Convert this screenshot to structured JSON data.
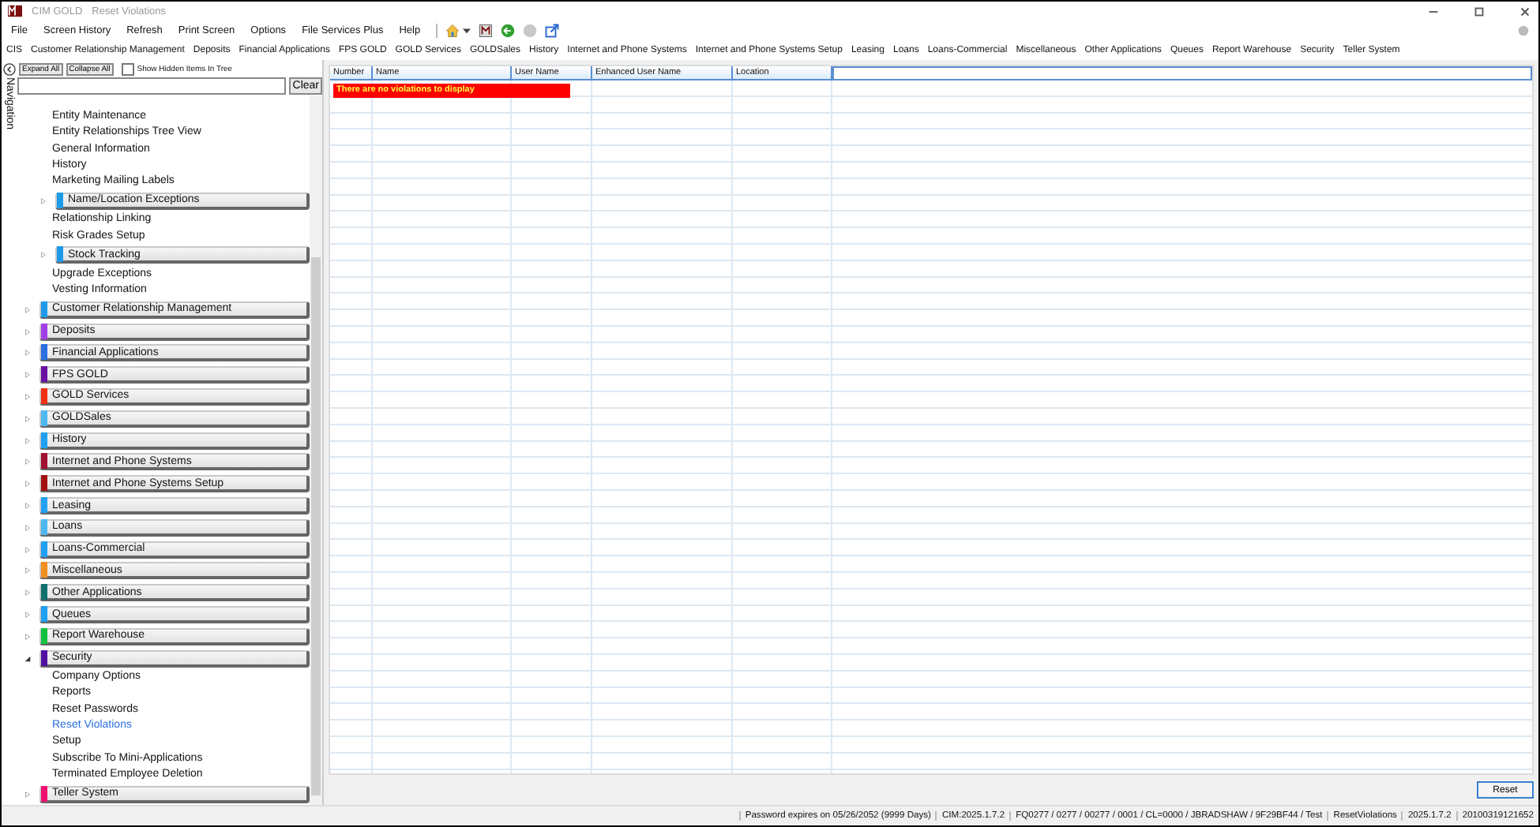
{
  "window": {
    "app_name": "CIM GOLD",
    "title": "Reset Violations"
  },
  "menu": [
    "File",
    "Screen History",
    "Refresh",
    "Print Screen",
    "Options",
    "File Services Plus",
    "Help"
  ],
  "modules": [
    "CIS",
    "Customer Relationship Management",
    "Deposits",
    "Financial Applications",
    "FPS GOLD",
    "GOLD Services",
    "GOLDSales",
    "History",
    "Internet and Phone Systems",
    "Internet and Phone Systems Setup",
    "Leasing",
    "Loans",
    "Loans-Commercial",
    "Miscellaneous",
    "Other Applications",
    "Queues",
    "Report Warehouse",
    "Security",
    "Teller System"
  ],
  "navigation": {
    "label": "Navigation",
    "expand_all": "Expand All",
    "collapse_all": "Collapse All",
    "show_hidden": {
      "label": "Show Hidden Items In Tree",
      "checked": false
    },
    "clear": "Clear",
    "continued_items": [
      {
        "kind": "leaf",
        "label": "Entity Maintenance",
        "selected": false
      },
      {
        "kind": "leaf",
        "label": "Entity Relationships Tree View",
        "selected": false
      },
      {
        "kind": "leaf",
        "label": "General Information",
        "selected": false
      },
      {
        "kind": "leaf",
        "label": "History",
        "selected": false
      },
      {
        "kind": "leaf",
        "label": "Marketing Mailing Labels",
        "selected": false
      },
      {
        "kind": "group",
        "label": "Name/Location Exceptions",
        "color": "#1e9be8",
        "expanded": false
      },
      {
        "kind": "leaf",
        "label": "Relationship Linking",
        "selected": false
      },
      {
        "kind": "leaf",
        "label": "Risk Grades Setup",
        "selected": false
      },
      {
        "kind": "group",
        "label": "Stock Tracking",
        "color": "#1e9be8",
        "expanded": false
      },
      {
        "kind": "leaf",
        "label": "Upgrade Exceptions",
        "selected": false
      },
      {
        "kind": "leaf",
        "label": "Vesting Information",
        "selected": false
      }
    ],
    "groups": [
      {
        "label": "Customer Relationship Management",
        "color": "#1e9be8",
        "expanded": false
      },
      {
        "label": "Deposits",
        "color": "#a040e8",
        "expanded": false
      },
      {
        "label": "Financial Applications",
        "color": "#2a6ee0",
        "expanded": false
      },
      {
        "label": "FPS GOLD",
        "color": "#6a10a0",
        "expanded": false
      },
      {
        "label": "GOLD Services",
        "color": "#f03010",
        "expanded": false
      },
      {
        "label": "GOLDSales",
        "color": "#50b8f0",
        "expanded": false
      },
      {
        "label": "History",
        "color": "#20a0f0",
        "expanded": false
      },
      {
        "label": "Internet and Phone Systems",
        "color": "#a01030",
        "expanded": false
      },
      {
        "label": "Internet and Phone Systems Setup",
        "color": "#a01010",
        "expanded": false
      },
      {
        "label": "Leasing",
        "color": "#20a0f0",
        "expanded": false
      },
      {
        "label": "Loans",
        "color": "#50b8f0",
        "expanded": false
      },
      {
        "label": "Loans-Commercial",
        "color": "#20a0f1",
        "expanded": false
      },
      {
        "label": "Miscellaneous",
        "color": "#f09020",
        "expanded": false
      },
      {
        "label": "Other Applications",
        "color": "#107070",
        "expanded": false
      },
      {
        "label": "Queues",
        "color": "#20a0f2",
        "expanded": false
      },
      {
        "label": "Report Warehouse",
        "color": "#10c040",
        "expanded": false
      },
      {
        "label": "Security",
        "color": "#5010a0",
        "expanded": true,
        "children": [
          {
            "label": "Company Options",
            "selected": false
          },
          {
            "label": "Reports",
            "selected": false
          },
          {
            "label": "Reset Passwords",
            "selected": false
          },
          {
            "label": "Reset Violations",
            "selected": true
          },
          {
            "label": "Setup",
            "selected": false
          },
          {
            "label": "Subscribe To Mini-Applications",
            "selected": false
          },
          {
            "label": "Terminated Employee Deletion",
            "selected": false
          }
        ]
      },
      {
        "label": "Teller System",
        "color": "#f01070",
        "expanded": false
      }
    ]
  },
  "table": {
    "columns": [
      "Number",
      "Name",
      "User Name",
      "Enhanced User Name",
      "Location"
    ],
    "empty_message": "There are no violations to display"
  },
  "reset_button": "Reset",
  "status_bar": [
    "Password expires on 05/26/2052 (9999 Days)",
    "CIM:2025.1.7.2",
    "FQ0277 / 0277 / 00277 / 0001 / CL=0000 / JBRADSHAW / 9F29BF44 / Test",
    "ResetViolations",
    "2025.1.7.2",
    "20100319121652"
  ]
}
